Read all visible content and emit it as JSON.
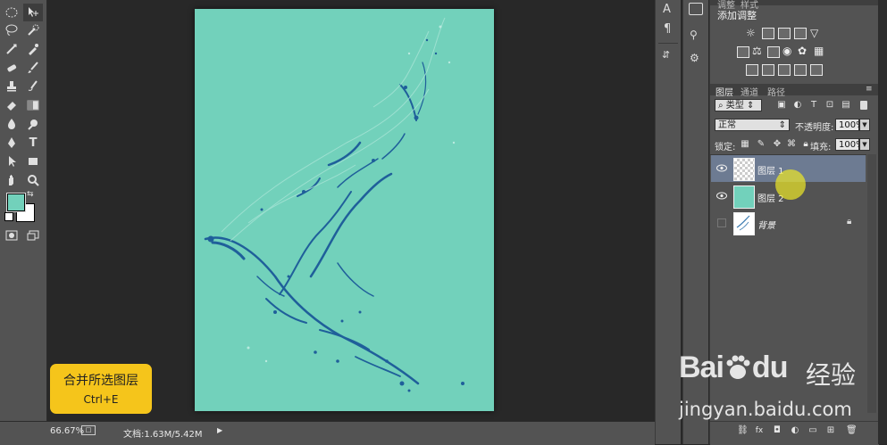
{
  "document": {
    "background_color": "#72d1bb",
    "splash_color": "#1f5f9a"
  },
  "status": {
    "zoom": "66.67%",
    "doc_size": "文档:1.63M/5.42M"
  },
  "panels": {
    "top_tabs": [
      "调整",
      "样式"
    ],
    "adjust_title": "添加调整",
    "layer_tabs": [
      "图层",
      "通道",
      "路径"
    ],
    "filter_label": "类型",
    "blend_mode": "正常",
    "opacity_label": "不透明度:",
    "opacity_value": "100%",
    "lock_label": "锁定:",
    "fill_label": "填充:",
    "fill_value": "100%"
  },
  "layers": [
    {
      "name": "图层 1",
      "visible": true,
      "selected": true,
      "thumb": "transparent-splash"
    },
    {
      "name": "图层 2",
      "visible": true,
      "selected": false,
      "thumb": "solid-teal"
    },
    {
      "name": "背景",
      "visible": false,
      "selected": false,
      "thumb": "white-splash",
      "locked": true
    }
  ],
  "shortcut_box": {
    "title": "合并所选图层",
    "keys": "Ctrl+E",
    "color": "#f5c51b"
  },
  "watermark": {
    "brand": "Bai",
    "brand2": "du",
    "cn": "经验",
    "url": "jingyan.baidu.com"
  },
  "colors": {
    "foreground": "#72d1bb",
    "background": "#ffffff",
    "selected_layer": "#6d7b92"
  }
}
